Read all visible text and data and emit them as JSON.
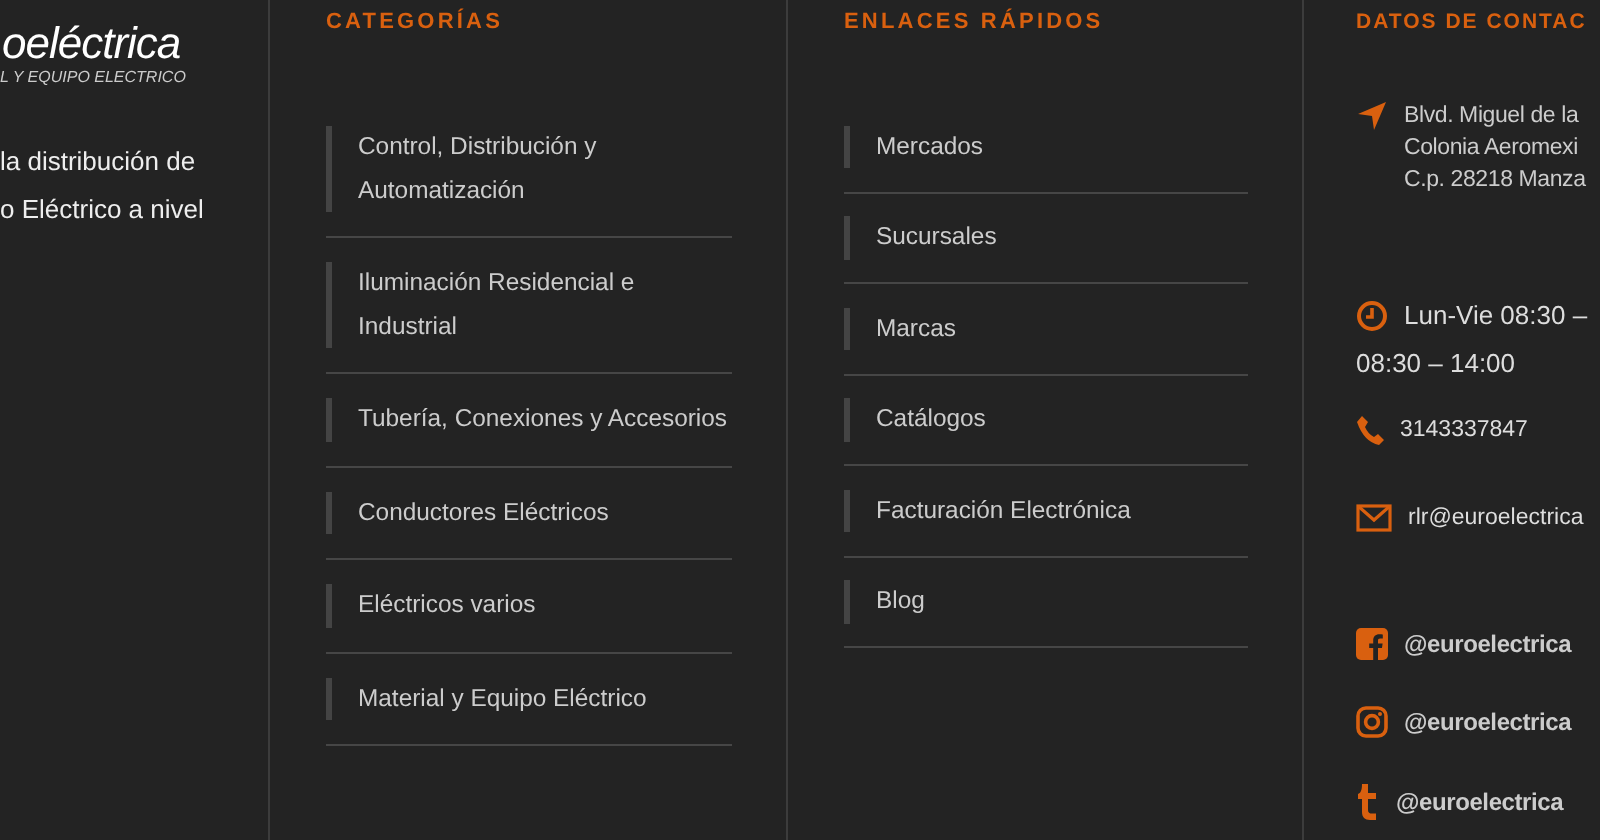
{
  "brand": {
    "logo": "oeléctrica",
    "tagline": "L Y EQUIPO ELECTRICO",
    "description": [
      "la distribución de",
      "o Eléctrico a nivel"
    ]
  },
  "columns": [
    {
      "title": "CATEGORÍAS",
      "links": [
        "Control, Distribución y Automatización",
        "Iluminación Residencial e Industrial",
        "Tubería, Conexiones y Accesorios",
        "Conductores Eléctricos",
        "Eléctricos varios",
        "Material y Equipo Eléctrico"
      ]
    },
    {
      "title": "ENLACES RÁPIDOS",
      "links": [
        "Mercados",
        "Sucursales",
        "Marcas",
        "Catálogos",
        "Facturación Electrónica",
        "Blog"
      ]
    }
  ],
  "contact": {
    "title": "DATOS DE CONTAC",
    "items": [
      {
        "kind": "address",
        "lines": [
          "Blvd. Miguel de la",
          "Colonia Aeromexi",
          "C.p. 28218 Manza"
        ]
      },
      {
        "kind": "hours",
        "lines": [
          "Lun-Vie 08:30 –",
          "08:30 – 14:00"
        ]
      },
      {
        "kind": "phone",
        "lines": [
          "3143337847"
        ]
      },
      {
        "kind": "email",
        "lines": [
          "rlr@euroelectrica"
        ]
      }
    ],
    "social": [
      {
        "kind": "facebook",
        "handle": "@euroelectrica"
      },
      {
        "kind": "instagram",
        "handle": "@euroelectrica"
      },
      {
        "kind": "tumblr",
        "handle": "@euroelectrica"
      }
    ]
  }
}
